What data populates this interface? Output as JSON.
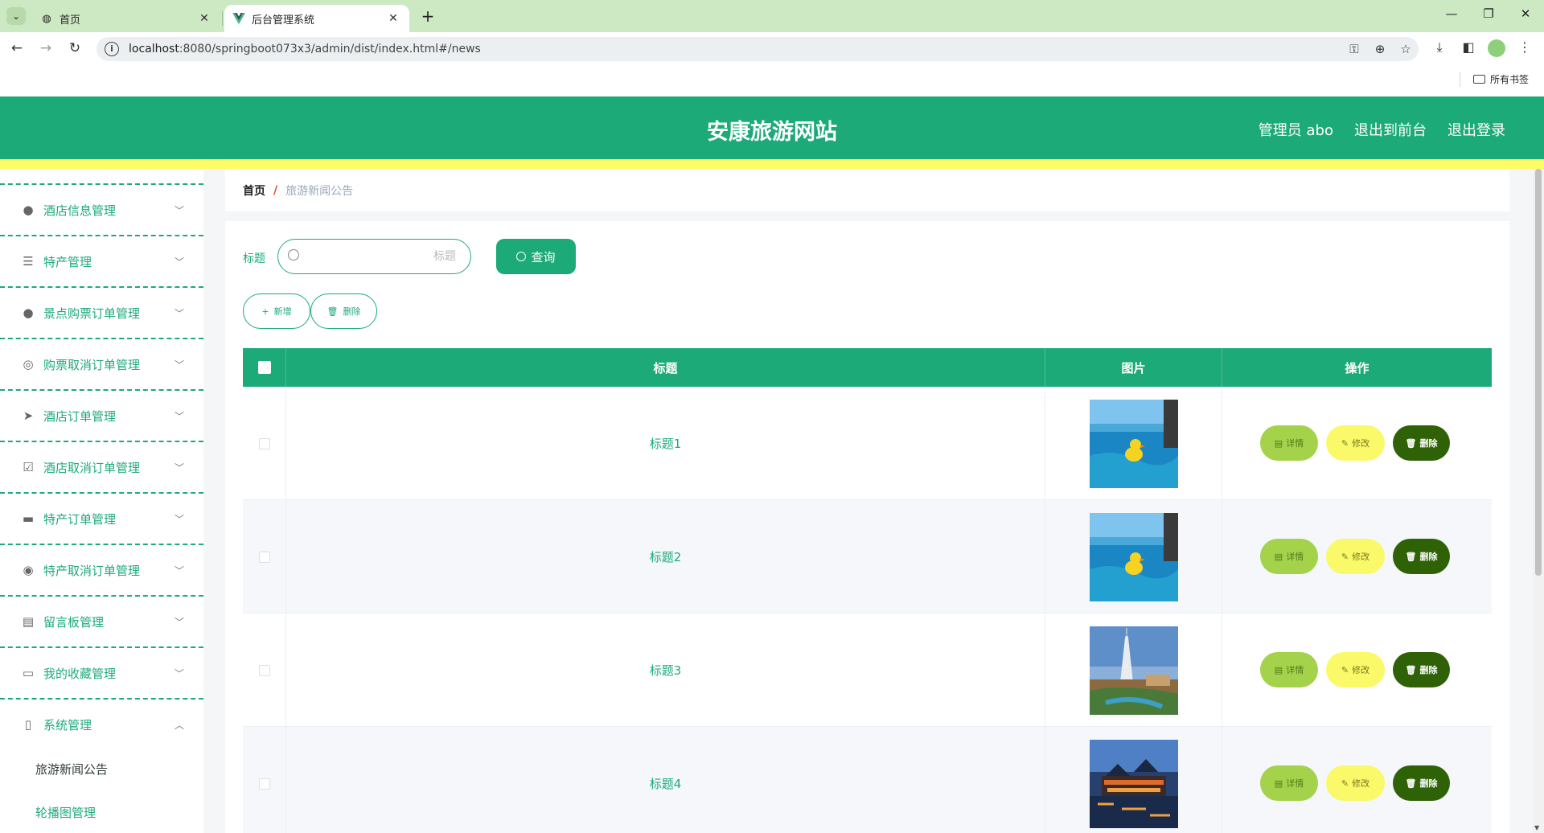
{
  "browser": {
    "tabs": [
      {
        "title": "首页",
        "active": false
      },
      {
        "title": "后台管理系统",
        "active": true
      }
    ],
    "url_host": "localhost",
    "url_rest": ":8080/springboot073x3/admin/dist/index.html#/news",
    "bookmark_label": "所有书签"
  },
  "header": {
    "title": "安康旅游网站",
    "user_label": "管理员 abo",
    "front_label": "退出到前台",
    "logout_label": "退出登录"
  },
  "sidebar": {
    "items": [
      {
        "label": "酒店信息管理",
        "icon": "pin-icon"
      },
      {
        "label": "特产管理",
        "icon": "sliders-icon"
      },
      {
        "label": "景点购票订单管理",
        "icon": "user-icon"
      },
      {
        "label": "购票取消订单管理",
        "icon": "compass-icon"
      },
      {
        "label": "酒店订单管理",
        "icon": "send-icon"
      },
      {
        "label": "酒店取消订单管理",
        "icon": "checklist-icon"
      },
      {
        "label": "特产订单管理",
        "icon": "monitor-icon"
      },
      {
        "label": "特产取消订单管理",
        "icon": "lifebuoy-icon"
      },
      {
        "label": "留言板管理",
        "icon": "clipboard-icon"
      },
      {
        "label": "我的收藏管理",
        "icon": "card-icon"
      },
      {
        "label": "系统管理",
        "icon": "phone-icon"
      }
    ],
    "sub_items": [
      "旅游新闻公告",
      "轮播图管理"
    ]
  },
  "breadcrumb": {
    "home": "首页",
    "separator": "/",
    "current": "旅游新闻公告"
  },
  "search": {
    "label": "标题",
    "placeholder": "标题",
    "button_label": "查询"
  },
  "toolbar": {
    "add_label": "新增",
    "delete_label": "删除"
  },
  "table": {
    "columns": [
      "标题",
      "图片",
      "操作"
    ],
    "rows": [
      {
        "title": "标题1",
        "image": "pool-duck"
      },
      {
        "title": "标题2",
        "image": "pool-duck"
      },
      {
        "title": "标题3",
        "image": "burj-resort"
      },
      {
        "title": "标题4",
        "image": "night-town"
      }
    ],
    "actions": {
      "detail": "详情",
      "edit": "修改",
      "delete": "删除"
    }
  },
  "colors": {
    "primary": "#1daa79",
    "accent_yellow": "#fdfb66",
    "detail_btn": "#a4d24a",
    "edit_btn": "#f9f96a",
    "delete_btn": "#2f6106"
  }
}
